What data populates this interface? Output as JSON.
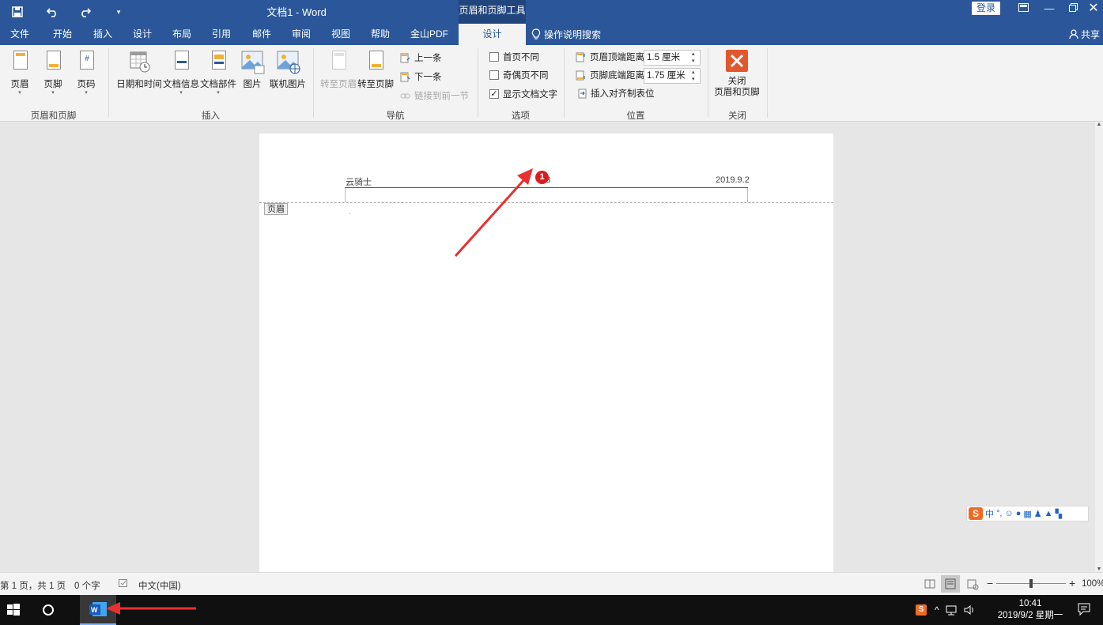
{
  "titlebar": {
    "doc_title": "文档1  -  Word",
    "context_tab": "页眉和页脚工具",
    "login": "登录",
    "quick_access": [
      "save-icon",
      "undo-icon",
      "redo-icon",
      "customize-icon"
    ]
  },
  "tabs": [
    {
      "label": "文件"
    },
    {
      "label": "开始"
    },
    {
      "label": "插入"
    },
    {
      "label": "设计"
    },
    {
      "label": "布局"
    },
    {
      "label": "引用"
    },
    {
      "label": "邮件"
    },
    {
      "label": "审阅"
    },
    {
      "label": "视图"
    },
    {
      "label": "帮助"
    },
    {
      "label": "金山PDF"
    },
    {
      "label": "设计",
      "active": true
    }
  ],
  "tell_me": "操作说明搜索",
  "share": "共享",
  "ribbon": {
    "groups": {
      "header_footer": {
        "label": "页眉和页脚",
        "buttons": [
          "页眉",
          "页脚",
          "页码"
        ]
      },
      "insert": {
        "label": "插入",
        "buttons": [
          "日期和时间",
          "文档信息",
          "文档部件",
          "图片",
          "联机图片"
        ]
      },
      "navigation": {
        "label": "导航",
        "goto_header": "转至页眉",
        "goto_footer": "转至页脚",
        "previous": "上一条",
        "next": "下一条",
        "link_previous": "链接到前一节"
      },
      "options": {
        "label": "选项",
        "first_page": "首页不同",
        "odd_even": "奇偶页不同",
        "show_text": "显示文档文字",
        "first_page_checked": false,
        "odd_even_checked": false,
        "show_text_checked": true
      },
      "position": {
        "label": "位置",
        "header_top_label": "页眉顶端距离:",
        "header_top_value": "1.5 厘米",
        "footer_bottom_label": "页脚底端距离:",
        "footer_bottom_value": "1.75 厘米",
        "insert_tab": "插入对齐制表位"
      },
      "close": {
        "label": "关闭",
        "button_line1": "关闭",
        "button_line2": "页眉和页脚"
      }
    }
  },
  "document": {
    "header_left": "云骑士",
    "header_center": "13",
    "header_right": "2019.9.2",
    "header_tag": "页眉",
    "click_marker": "1"
  },
  "statusbar": {
    "page_info": "第 1 页，共 1 页",
    "word_count": "0 个字",
    "language": "中文(中国)",
    "zoom": "100%"
  },
  "ime": {
    "logo": "S",
    "mode": "中"
  },
  "taskbar": {
    "time": "10:41",
    "date": "2019/9/2 星期一"
  },
  "colors": {
    "word_blue": "#2b579a",
    "annotation_red": "#e83030"
  }
}
